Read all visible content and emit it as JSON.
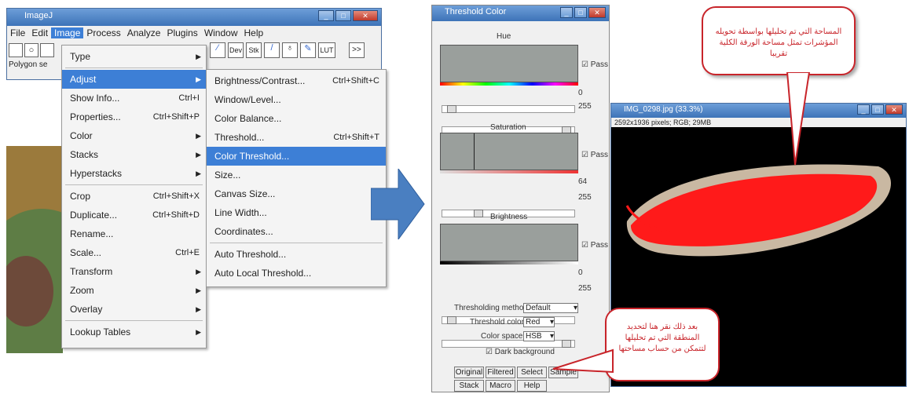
{
  "imagej": {
    "title": "ImageJ",
    "menubar": [
      "File",
      "Edit",
      "Image",
      "Process",
      "Analyze",
      "Plugins",
      "Window",
      "Help"
    ],
    "active_menu": "Image",
    "toolbar_right": [
      "Dev",
      "Stk",
      "LUT"
    ],
    "status": "Polygon se"
  },
  "image_menu": {
    "items": [
      {
        "label": "Type",
        "shortcut": "",
        "submenu": true
      },
      {
        "label": "Adjust",
        "shortcut": "",
        "submenu": true,
        "selected": true
      },
      {
        "label": "Show Info...",
        "shortcut": "Ctrl+I"
      },
      {
        "label": "Properties...",
        "shortcut": "Ctrl+Shift+P"
      },
      {
        "label": "Color",
        "shortcut": "",
        "submenu": true
      },
      {
        "label": "Stacks",
        "shortcut": "",
        "submenu": true
      },
      {
        "label": "Hyperstacks",
        "shortcut": "",
        "submenu": true
      },
      {
        "label": "Crop",
        "shortcut": "Ctrl+Shift+X"
      },
      {
        "label": "Duplicate...",
        "shortcut": "Ctrl+Shift+D"
      },
      {
        "label": "Rename...",
        "shortcut": ""
      },
      {
        "label": "Scale...",
        "shortcut": "Ctrl+E"
      },
      {
        "label": "Transform",
        "shortcut": "",
        "submenu": true
      },
      {
        "label": "Zoom",
        "shortcut": "",
        "submenu": true
      },
      {
        "label": "Overlay",
        "shortcut": "",
        "submenu": true
      },
      {
        "label": "Lookup Tables",
        "shortcut": "",
        "submenu": true
      }
    ]
  },
  "adjust_menu": {
    "items": [
      {
        "label": "Brightness/Contrast...",
        "shortcut": "Ctrl+Shift+C"
      },
      {
        "label": "Window/Level...",
        "shortcut": ""
      },
      {
        "label": "Color Balance...",
        "shortcut": ""
      },
      {
        "label": "Threshold...",
        "shortcut": "Ctrl+Shift+T"
      },
      {
        "label": "Color Threshold...",
        "shortcut": "",
        "selected": true
      },
      {
        "label": "Size...",
        "shortcut": ""
      },
      {
        "label": "Canvas Size...",
        "shortcut": ""
      },
      {
        "label": "Line Width...",
        "shortcut": ""
      },
      {
        "label": "Coordinates...",
        "shortcut": ""
      },
      {
        "label": "Auto Threshold...",
        "shortcut": ""
      },
      {
        "label": "Auto Local Threshold...",
        "shortcut": ""
      }
    ]
  },
  "threshold_color": {
    "title": "Threshold Color",
    "hue_label": "Hue",
    "saturation_label": "Saturation",
    "brightness_label": "Brightness",
    "pass_label": "Pass",
    "hue_min": "0",
    "hue_max": "255",
    "sat_min": "64",
    "sat_max": "255",
    "bri_min": "0",
    "bri_max": "255",
    "method_label": "Thresholding method:",
    "method_value": "Default",
    "color_label": "Threshold color:",
    "color_value": "Red",
    "space_label": "Color space:",
    "space_value": "HSB",
    "dark_bg": "Dark background",
    "buttons_row1": [
      "Original",
      "Filtered",
      "Select",
      "Sample"
    ],
    "buttons_row2": [
      "Stack",
      "Macro",
      "Help"
    ]
  },
  "image_window": {
    "title": "IMG_0298.jpg (33.3%)",
    "info": "2592x1936 pixels; RGB; 29MB"
  },
  "callouts": {
    "top": "المساحة التي تم تحليلها بواسطة تحويله المؤشرات تمثل مساحة الورقة الكلية تقريبا",
    "bottom": "بعد ذلك نقر هنا لتحديد المنطقة التي تم تحليلها لتتمكن من حساب مساحتها"
  },
  "colors": {
    "highlight": "#3d7fd6",
    "arrow": "#4a7fc1",
    "callout": "#c8242a",
    "leaf": "#ff1a1a"
  }
}
